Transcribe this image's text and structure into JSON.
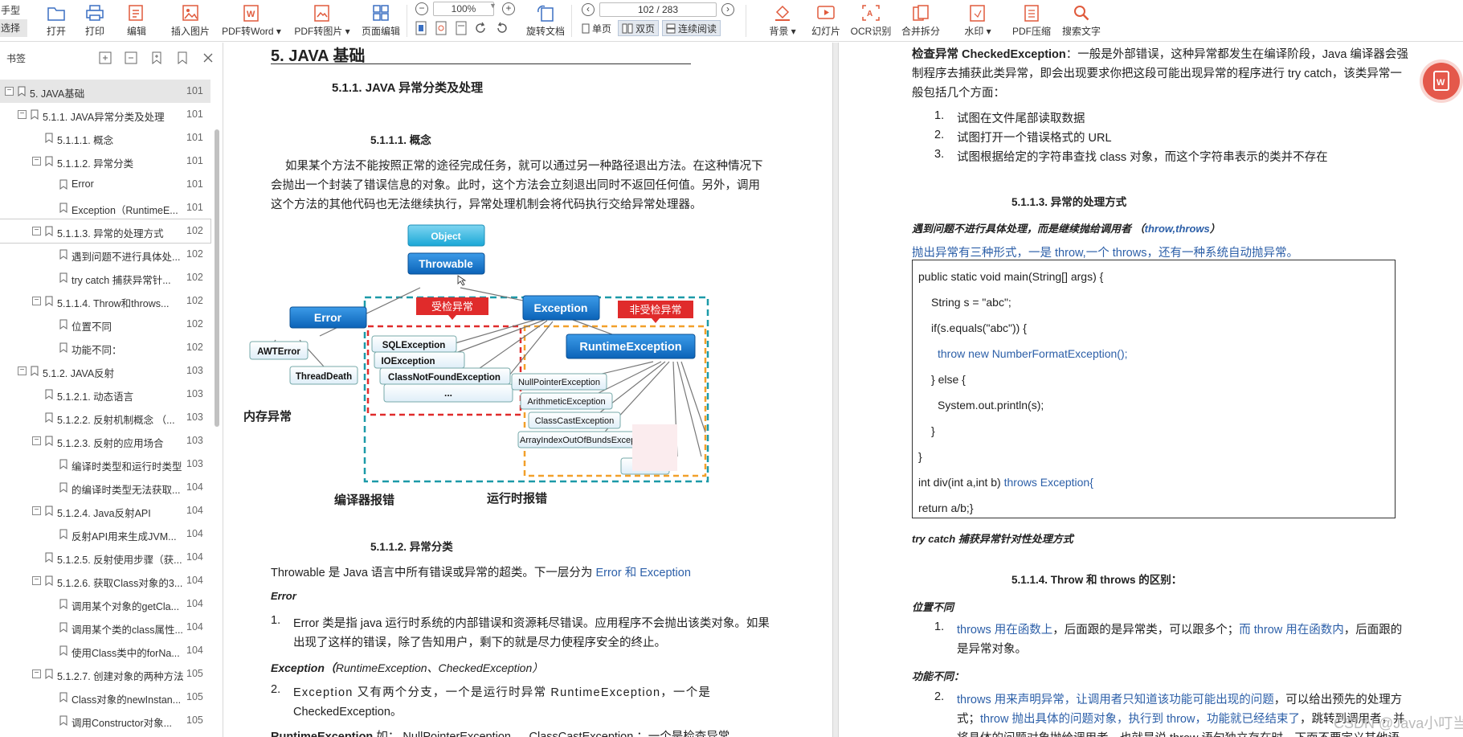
{
  "toolbar": {
    "mode_top": "手型",
    "mode_select": "选择",
    "open": "打开",
    "print": "打印",
    "edit": "编辑",
    "insert_image": "插入图片",
    "pdf_to_word": "PDF转Word",
    "pdf_to_image": "PDF转图片",
    "page_edit": "页面编辑",
    "zoom": "100%",
    "rotate_doc": "旋转文档",
    "page_indicator": "102 / 283",
    "single_page": "单页",
    "double_page": "双页",
    "continuous_read": "连续阅读",
    "background": "背景",
    "slideshow": "幻灯片",
    "ocr": "OCR识别",
    "merge_split": "合并拆分",
    "watermark": "水印",
    "pdf_compress": "PDF压缩",
    "search_text": "搜索文字"
  },
  "sidebar": {
    "title": "书签",
    "items": [
      {
        "label": "5. JAVA基础",
        "page": "101",
        "toggle": "−"
      },
      {
        "label": "5.1.1. JAVA异常分类及处理",
        "page": "101",
        "toggle": "−"
      },
      {
        "label": "5.1.1.1. 概念",
        "page": "101",
        "toggle": ""
      },
      {
        "label": "5.1.1.2. 异常分类",
        "page": "101",
        "toggle": "−"
      },
      {
        "label": "Error",
        "page": "101",
        "toggle": ""
      },
      {
        "label": "Exception（RuntimeE...",
        "page": "101",
        "toggle": ""
      },
      {
        "label": "5.1.1.3. 异常的处理方式",
        "page": "102",
        "toggle": "−"
      },
      {
        "label": "遇到问题不进行具体处...",
        "page": "102",
        "toggle": ""
      },
      {
        "label": "try catch 捕获异常针...",
        "page": "102",
        "toggle": ""
      },
      {
        "label": "5.1.1.4. Throw和throws...",
        "page": "102",
        "toggle": "−"
      },
      {
        "label": "位置不同",
        "page": "102",
        "toggle": ""
      },
      {
        "label": "功能不同：",
        "page": "102",
        "toggle": ""
      },
      {
        "label": "5.1.2. JAVA反射",
        "page": "103",
        "toggle": "−"
      },
      {
        "label": "5.1.2.1. 动态语言",
        "page": "103",
        "toggle": ""
      },
      {
        "label": "5.1.2.2. 反射机制概念 （...",
        "page": "103",
        "toggle": ""
      },
      {
        "label": "5.1.2.3. 反射的应用场合",
        "page": "103",
        "toggle": "−"
      },
      {
        "label": "编译时类型和运行时类型",
        "page": "103",
        "toggle": ""
      },
      {
        "label": "的编译时类型无法获取...",
        "page": "104",
        "toggle": ""
      },
      {
        "label": "5.1.2.4. Java反射API",
        "page": "104",
        "toggle": "−"
      },
      {
        "label": "反射API用来生成JVM...",
        "page": "104",
        "toggle": ""
      },
      {
        "label": "5.1.2.5. 反射使用步骤（获...",
        "page": "104",
        "toggle": ""
      },
      {
        "label": "5.1.2.6. 获取Class对象的3...",
        "page": "104",
        "toggle": "−"
      },
      {
        "label": "调用某个对象的getCla...",
        "page": "104",
        "toggle": ""
      },
      {
        "label": "调用某个类的class属性...",
        "page": "104",
        "toggle": ""
      },
      {
        "label": "使用Class类中的forNa...",
        "page": "104",
        "toggle": ""
      },
      {
        "label": "5.1.2.7. 创建对象的两种方法",
        "page": "105",
        "toggle": "−"
      },
      {
        "label": "Class对象的newInstan...",
        "page": "105",
        "toggle": ""
      },
      {
        "label": "调用Constructor对象...",
        "page": "105",
        "toggle": ""
      }
    ]
  },
  "left_page": {
    "h1": "5. JAVA 基础",
    "h2": "5.1.1.  JAVA 异常分类及处理",
    "h3_concept": "5.1.1.1.     概念",
    "concept_lines": [
      "如果某个方法不能按照正常的途径完成任务，就可以通过另一种路径退出方法。在这种情况下",
      "会抛出一个封装了错误信息的对象。此时，这个方法会立刻退出同时不返回任何值。另外，调用",
      "这个方法的其他代码也无法继续执行，异常处理机制会将代码执行交给异常处理器。"
    ],
    "h3_category": "5.1.1.2.     异常分类",
    "throwable_line_pre": "Throwable 是 Java 语言中所有错误或异常的超类。下一层分为 ",
    "throwable_line_blue": "Error 和 Exception",
    "error_heading": "Error",
    "item1_num": "1.",
    "item1_lines": [
      "Error 类是指 java 运行时系统的内部错误和资源耗尽错误。应用程序不会抛出该类对象。如果",
      "出现了这样的错误，除了告知用户，剩下的就是尽力使程序安全的终止。"
    ],
    "exception_heading_pre": "Exception（",
    "exception_heading_it": "RuntimeException、CheckedException",
    "exception_heading_post": "）",
    "item2_num": "2.",
    "item2_lines": [
      "Exception 又有两个分支，一个是运行时异常 RuntimeException，一个是",
      "CheckedException。"
    ],
    "runtime_line_bold": "RuntimeException",
    "runtime_line_rest": " 如： NullPointerException 、 ClassCastException ；一个是检查异常"
  },
  "diagram": {
    "object": "Object",
    "throwable": "Throwable",
    "error": "Error",
    "exception": "Exception",
    "checked_tag": "受检异常",
    "unchecked_tag": "非受检异常",
    "runtime": "RuntimeException",
    "awt_error": "AWTError",
    "thread_death": "ThreadDeath",
    "sql_exception": "SQLException",
    "io_exception": "IOException",
    "class_not_found": "ClassNotFoundException",
    "ellipsis": "...",
    "npe": "NullPointerException",
    "arithmetic": "ArithmeticException",
    "class_cast": "ClassCastException",
    "array_index": "ArrayIndexOutOfBundsExcep",
    "memory_label": "内存异常",
    "compiler_label": "编译器报错",
    "runtime_label": "运行时报错"
  },
  "right_page": {
    "checked_bold": "检查异常 CheckedException",
    "checked_lines": [
      "：一般是外部错误，这种异常都发生在编译阶段，Java 编译器会强",
      "制程序去捕获此类异常，即会出现要求你把这段可能出现异常的程序进行 try catch，该类异常一",
      "般包括几个方面："
    ],
    "list": [
      {
        "num": "1.",
        "text": "试图在文件尾部读取数据"
      },
      {
        "num": "2.",
        "text": "试图打开一个错误格式的 URL"
      },
      {
        "num": "3.",
        "text": "试图根据给定的字符串查找 class 对象，而这个字符串表示的类并不存在"
      }
    ],
    "h3_handle": "5.1.1.3.     异常的处理方式",
    "handle_it_pre": "遇到问题不进行具体处理，而是继续抛给调用者 （",
    "handle_it_blue": "throw,throws",
    "handle_it_post": "）",
    "throw_forms": "抛出异常有三种形式，一是 throw,一个 throws，还有一种系统自动抛异常。",
    "code": [
      "public static void main(String[] args) {",
      "String s = \"abc\";",
      "if(s.equals(\"abc\")) {",
      "throw new NumberFormatException();",
      "} else {",
      "System.out.println(s);",
      "}",
      "}",
      "int div(int a,int b) ",
      "throws Exception{",
      "return a/b;}"
    ],
    "trycatch": "try catch 捕获异常针对性处理方式",
    "h3_diff": "5.1.1.4.     Throw 和 throws 的区别：",
    "pos_heading": "位置不同",
    "pos_num": "1.",
    "pos_blue1": "throws 用在函数上",
    "pos_t1": "，后面跟的是异常类，可以跟多个；",
    "pos_blue2": "而 throw 用在函数内",
    "pos_t2": "，后面跟的",
    "pos_line2": "是异常对象。",
    "func_heading": "功能不同：",
    "func_num": "2.",
    "func_blue1": "throws 用来声明异常，让调用者只知道该功能可能出现的问题",
    "func_t1": "，可以给出预先的处理方",
    "func_t2": "式；",
    "func_blue2": "throw 抛出具体的问题对象，执行到 throw，功能就已经结束了",
    "func_t3": "，跳转到调用者，并",
    "func_line3": "将具体的问题对象抛给调用者。也就是说 throw 语句独立存在时，下面不要定义其他语"
  },
  "watermark": "CSDN @Java小叮当",
  "colors": {
    "accent_blue": "#2c5fa8",
    "float_btn": "#e4584b"
  }
}
